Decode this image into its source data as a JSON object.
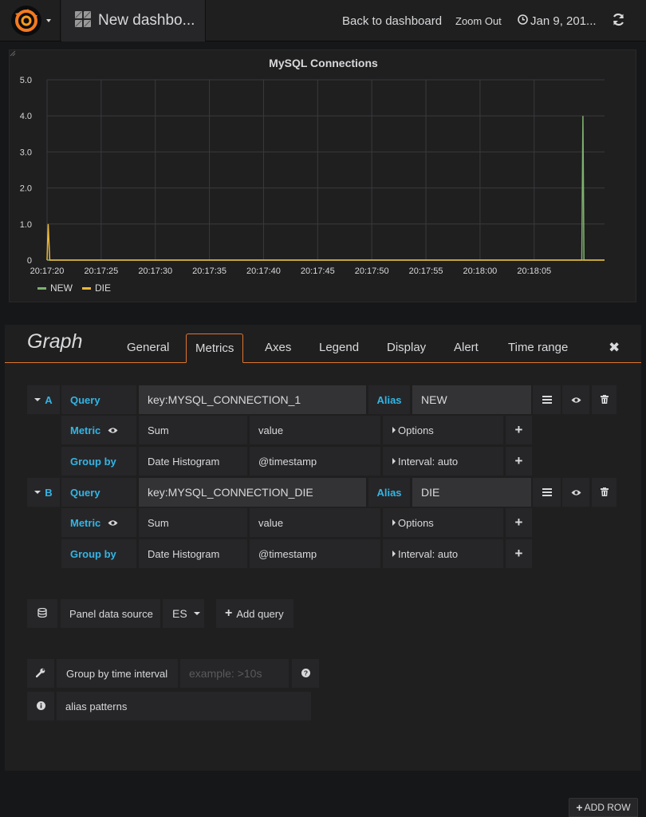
{
  "navbar": {
    "dashboard_title": "New dashbo...",
    "back_label": "Back to dashboard",
    "zoom_label": "Zoom Out",
    "time_label": "Jan 9, 201..."
  },
  "colors": {
    "accent": "#e0752d",
    "label_blue": "#33b5e5",
    "series_new": "#7eb26d",
    "series_die": "#eab839"
  },
  "panel": {
    "title": "MySQL Connections",
    "legend": [
      {
        "name": "NEW",
        "color": "#7eb26d"
      },
      {
        "name": "DIE",
        "color": "#eab839"
      }
    ]
  },
  "chart_data": {
    "type": "line",
    "title": "MySQL Connections",
    "y_ticks": [
      "5.0",
      "4.0",
      "3.0",
      "2.0",
      "1.0",
      "0"
    ],
    "x_ticks": [
      "20:17:20",
      "20:17:25",
      "20:17:30",
      "20:17:35",
      "20:17:40",
      "20:17:45",
      "20:17:50",
      "20:17:55",
      "20:18:00",
      "20:18:05"
    ],
    "ylim": [
      0,
      5
    ],
    "xlim_seconds": [
      0,
      51.5
    ],
    "grid": true,
    "legend_position": "bottom-left",
    "series": [
      {
        "name": "NEW",
        "color": "#7eb26d",
        "points": [
          [
            0,
            0
          ],
          [
            49.4,
            0
          ],
          [
            49.5,
            4
          ],
          [
            49.6,
            0
          ],
          [
            51.5,
            0
          ]
        ]
      },
      {
        "name": "DIE",
        "color": "#eab839",
        "points": [
          [
            0,
            0
          ],
          [
            0.1,
            1
          ],
          [
            0.25,
            0
          ],
          [
            49.4,
            0
          ],
          [
            49.5,
            0
          ],
          [
            51.5,
            0
          ]
        ]
      }
    ]
  },
  "editor": {
    "title": "Graph",
    "tabs": [
      "General",
      "Metrics",
      "Axes",
      "Legend",
      "Display",
      "Alert",
      "Time range"
    ],
    "active_tab": "Metrics",
    "queries": [
      {
        "ref": "A",
        "query_label": "Query",
        "query": "key:MYSQL_CONNECTION_1",
        "alias_label": "Alias",
        "alias": "NEW",
        "metric_label": "Metric",
        "metric_type": "Sum",
        "metric_field": "value",
        "options_label": "Options",
        "groupby_label": "Group by",
        "groupby_type": "Date Histogram",
        "groupby_field": "@timestamp",
        "interval_label": "Interval: auto"
      },
      {
        "ref": "B",
        "query_label": "Query",
        "query": "key:MYSQL_CONNECTION_DIE",
        "alias_label": "Alias",
        "alias": "DIE",
        "metric_label": "Metric",
        "metric_type": "Sum",
        "metric_field": "value",
        "options_label": "Options",
        "groupby_label": "Group by",
        "groupby_type": "Date Histogram",
        "groupby_field": "@timestamp",
        "interval_label": "Interval: auto"
      }
    ],
    "datasource_label": "Panel data source",
    "datasource_value": "ES",
    "add_query_label": "Add query",
    "group_interval_label": "Group by time interval",
    "group_interval_placeholder": "example: >10s",
    "alias_patterns_label": "alias patterns"
  },
  "add_row_label": "ADD ROW"
}
